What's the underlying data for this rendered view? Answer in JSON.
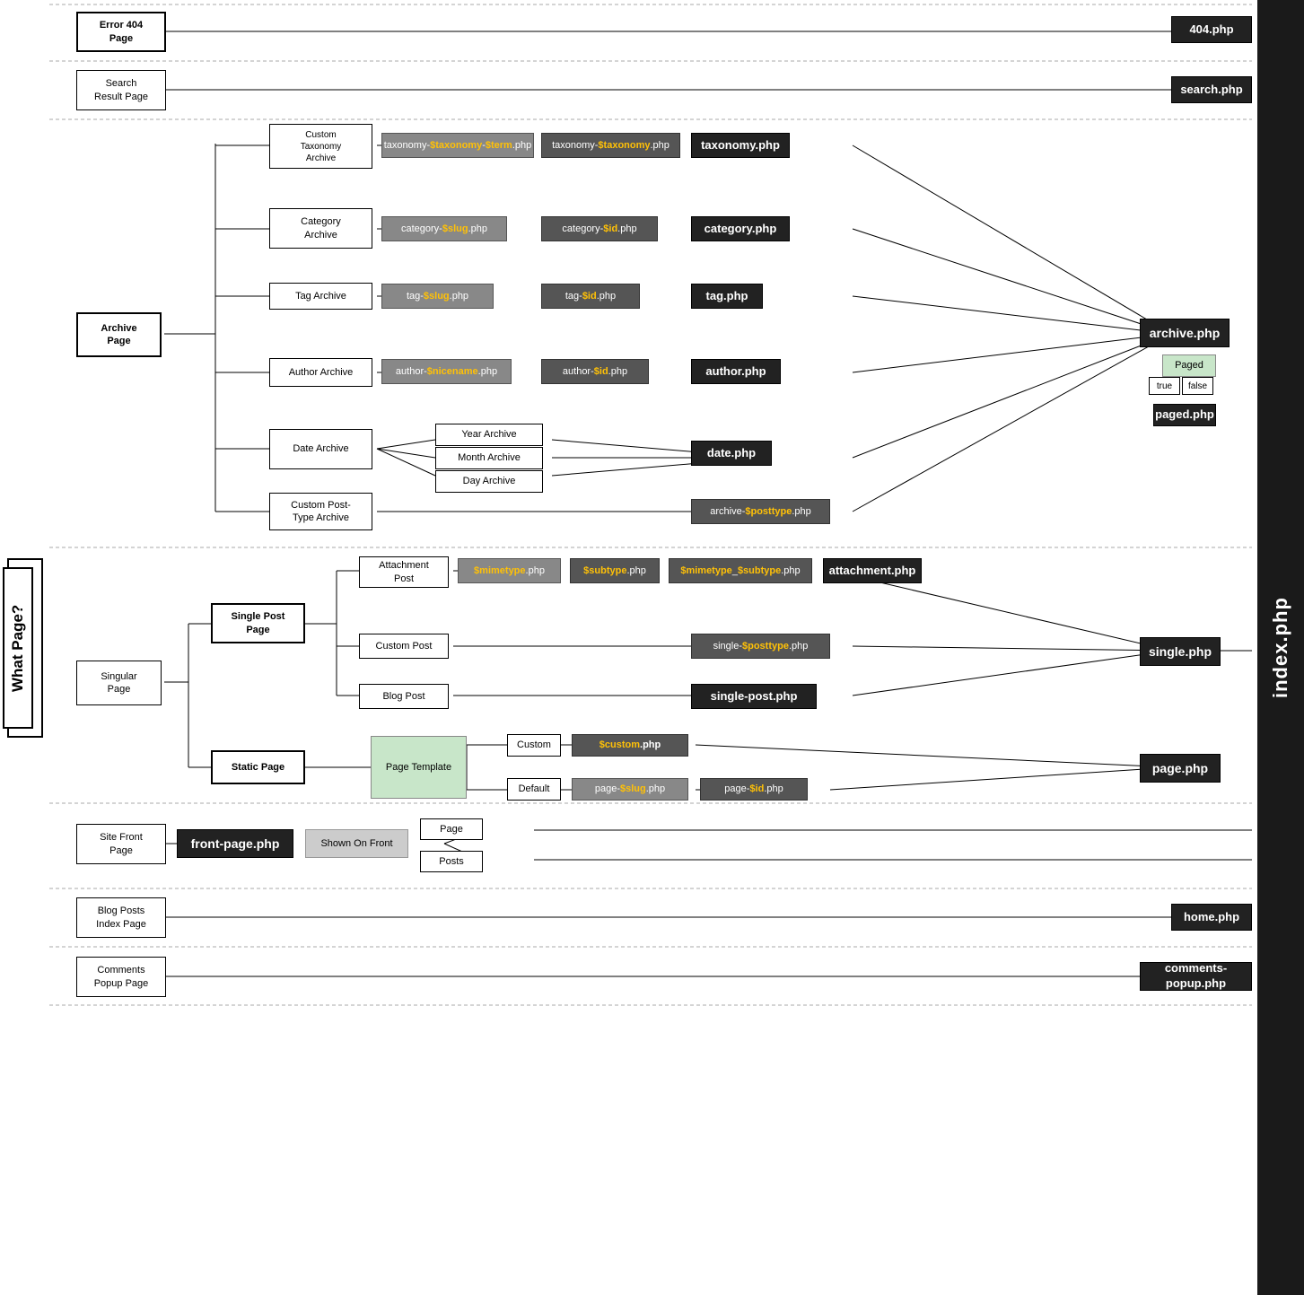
{
  "title": "What Page?",
  "index_label": "index.php",
  "sections": [
    {
      "id": "error404",
      "label": "Error 404\nPage",
      "php": "404.php"
    },
    {
      "id": "search",
      "label": "Search\nResult Page",
      "php": "search.php"
    },
    {
      "id": "archive",
      "label": "Archive\nPage",
      "php": "archive.php",
      "sub_php": "paged.php",
      "children": [
        {
          "id": "custom-taxonomy",
          "label": "Custom\nTaxonomy\nArchive",
          "chain": [
            {
              "label": "taxonomy-$taxonomy-$term.php",
              "type": "gray",
              "yellow": [
                "$taxonomy",
                "$term"
              ]
            },
            {
              "label": "taxonomy-$taxonomy.php",
              "type": "medium",
              "yellow": [
                "$taxonomy"
              ]
            },
            {
              "label": "taxonomy.php",
              "type": "dark"
            }
          ]
        },
        {
          "id": "category",
          "label": "Category\nArchive",
          "chain": [
            {
              "label": "category-$slug.php",
              "type": "gray",
              "yellow": [
                "$slug"
              ]
            },
            {
              "label": "category-$id.php",
              "type": "medium",
              "yellow": [
                "$id"
              ]
            },
            {
              "label": "category.php",
              "type": "dark"
            }
          ]
        },
        {
          "id": "tag",
          "label": "Tag Archive",
          "chain": [
            {
              "label": "tag-$slug.php",
              "type": "gray",
              "yellow": [
                "$slug"
              ]
            },
            {
              "label": "tag-$id.php",
              "type": "medium",
              "yellow": [
                "$id"
              ]
            },
            {
              "label": "tag.php",
              "type": "dark"
            }
          ]
        },
        {
          "id": "author",
          "label": "Author Archive",
          "chain": [
            {
              "label": "author-$nicename.php",
              "type": "gray",
              "yellow": [
                "$nicename"
              ]
            },
            {
              "label": "author-$id.php",
              "type": "medium",
              "yellow": [
                "$id"
              ]
            },
            {
              "label": "author.php",
              "type": "dark"
            }
          ]
        },
        {
          "id": "date",
          "label": "Date Archive",
          "date_children": [
            "Year Archive",
            "Month Archive",
            "Day Archive"
          ],
          "php": "date.php"
        },
        {
          "id": "custom-post-type",
          "label": "Custom Post-\nType Archive",
          "chain": [
            {
              "label": "archive-$posttype.php",
              "type": "medium",
              "yellow": [
                "$posttype"
              ]
            }
          ]
        }
      ]
    },
    {
      "id": "singular",
      "label": "Singular\nPage",
      "children": [
        {
          "id": "single-post",
          "label": "Single Post\nPage",
          "php": "single.php",
          "children": [
            {
              "id": "attachment",
              "label": "Attachment\nPost",
              "chain": [
                {
                  "label": "$mimetype.php",
                  "type": "gray",
                  "yellow": [
                    "$mimetype"
                  ]
                },
                {
                  "label": "$subtype.php",
                  "type": "medium",
                  "yellow": [
                    "$subtype"
                  ]
                },
                {
                  "label": "$mimetype_$subtype.php",
                  "type": "medium",
                  "yellow": [
                    "$mimetype",
                    "$subtype"
                  ]
                },
                {
                  "label": "attachment.php",
                  "type": "dark"
                }
              ]
            },
            {
              "id": "custom-post",
              "label": "Custom Post",
              "chain": [
                {
                  "label": "single-$posttype.php",
                  "type": "medium",
                  "yellow": [
                    "$posttype"
                  ]
                }
              ]
            },
            {
              "id": "blog-post",
              "label": "Blog Post",
              "chain": [
                {
                  "label": "single-post.php",
                  "type": "dark"
                }
              ]
            }
          ]
        },
        {
          "id": "static-page",
          "label": "Static Page",
          "children": [
            {
              "id": "page-template",
              "label": "Page Template",
              "type": "green",
              "children": [
                {
                  "id": "custom-template",
                  "label": "Custom",
                  "chain": [
                    {
                      "label": "$custom.php",
                      "type": "medium",
                      "yellow": [
                        "$custom"
                      ]
                    }
                  ]
                },
                {
                  "id": "default-template",
                  "label": "Default",
                  "chain": [
                    {
                      "label": "page-$slug.php",
                      "type": "gray",
                      "yellow": [
                        "$slug"
                      ]
                    },
                    {
                      "label": "page-$id.php",
                      "type": "medium",
                      "yellow": [
                        "$id"
                      ]
                    }
                  ]
                }
              ],
              "php": "page.php"
            }
          ]
        }
      ]
    },
    {
      "id": "site-front",
      "label": "Site Front\nPage",
      "php_bold": "front-page.php",
      "shown_on_front": "Shown On Front",
      "children": [
        "Page",
        "Posts"
      ]
    },
    {
      "id": "blog-posts-index",
      "label": "Blog Posts\nIndex Page",
      "php": "home.php"
    },
    {
      "id": "comments-popup",
      "label": "Comments\nPopup Page",
      "php": "comments-popup.php"
    }
  ],
  "paged_label": "Paged",
  "paged_true": "true",
  "paged_false": "false"
}
